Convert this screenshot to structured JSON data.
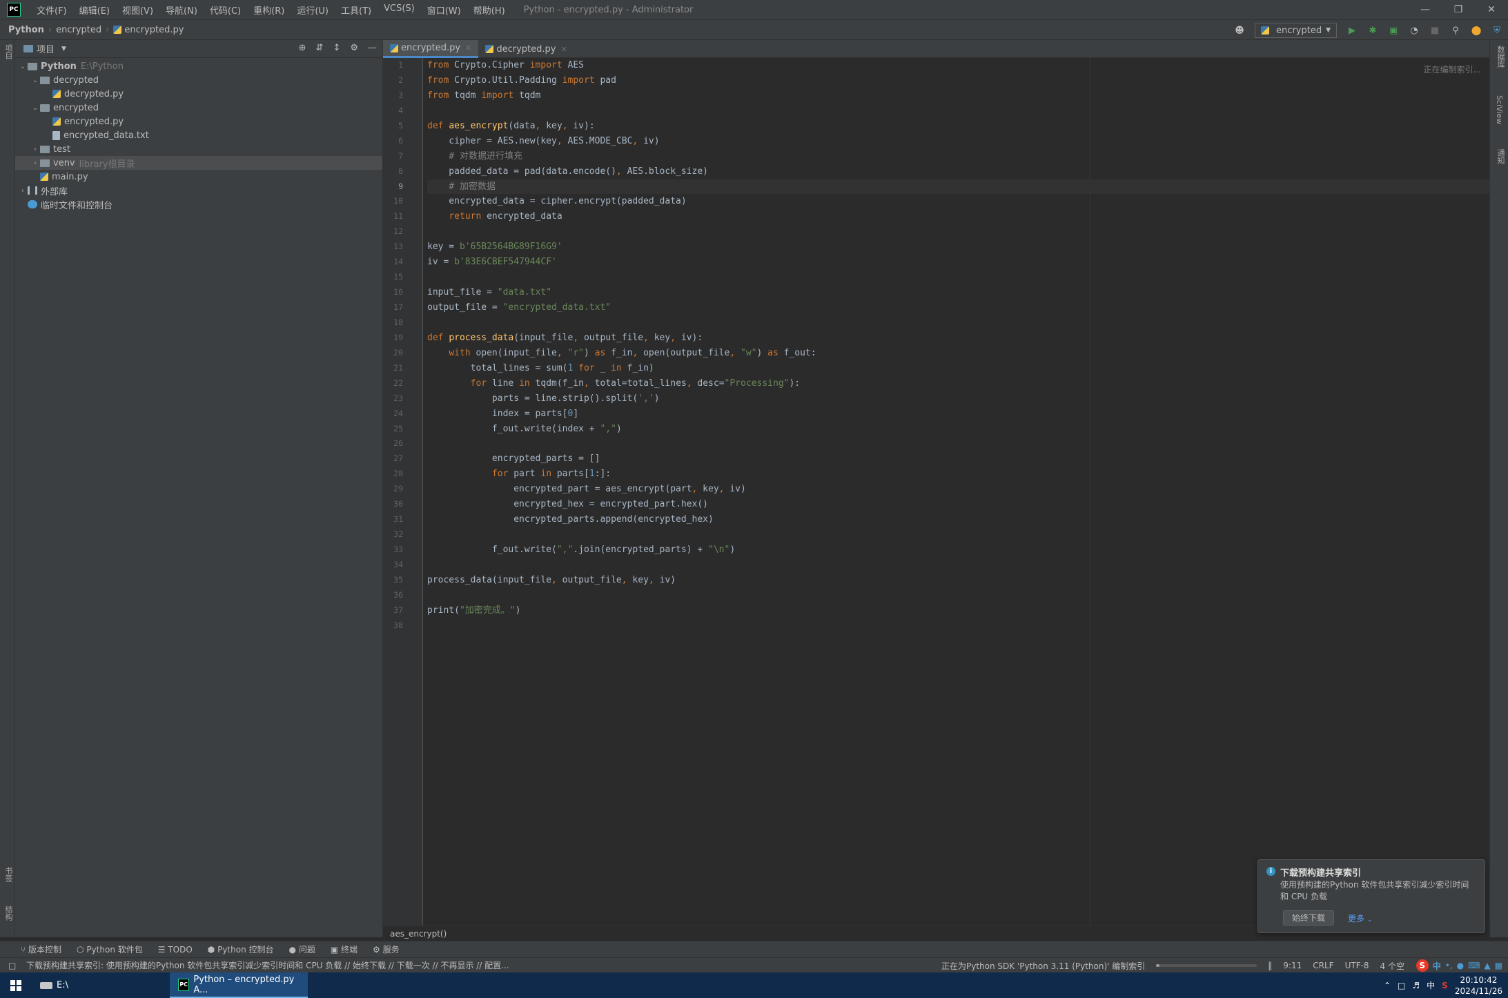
{
  "window": {
    "title": "Python - encrypted.py - Administrator",
    "menu": [
      "文件(F)",
      "编辑(E)",
      "视图(V)",
      "导航(N)",
      "代码(C)",
      "重构(R)",
      "运行(U)",
      "工具(T)",
      "VCS(S)",
      "窗口(W)",
      "帮助(H)"
    ],
    "logo": "PC"
  },
  "navbar": {
    "breadcrumb": [
      "Python",
      "encrypted",
      "encrypted.py"
    ],
    "run_config": "encrypted"
  },
  "project": {
    "header": "项目",
    "tree": [
      {
        "label": "Python",
        "hint": "E:\\Python",
        "depth": 0,
        "type": "folder",
        "expanded": true,
        "bold": true
      },
      {
        "label": "decrypted",
        "depth": 1,
        "type": "folder",
        "expanded": true
      },
      {
        "label": "decrypted.py",
        "depth": 2,
        "type": "py"
      },
      {
        "label": "encrypted",
        "depth": 1,
        "type": "folder",
        "expanded": true
      },
      {
        "label": "encrypted.py",
        "depth": 2,
        "type": "py"
      },
      {
        "label": "encrypted_data.txt",
        "depth": 2,
        "type": "txt"
      },
      {
        "label": "test",
        "depth": 1,
        "type": "folder",
        "expanded": false
      },
      {
        "label": "venv",
        "hint": "library根目录",
        "depth": 1,
        "type": "folder",
        "expanded": false,
        "selected": true
      },
      {
        "label": "main.py",
        "depth": 1,
        "type": "py"
      },
      {
        "label": "外部库",
        "depth": 0,
        "type": "lib",
        "expanded": false
      },
      {
        "label": "临时文件和控制台",
        "depth": 0,
        "type": "scratch"
      }
    ]
  },
  "left_strip": {
    "top_label": "项目",
    "bottom_labels": [
      "书签",
      "结构"
    ]
  },
  "right_strip": {
    "labels": [
      "数据库",
      "SciView",
      "通知"
    ]
  },
  "tabs": [
    {
      "label": "encrypted.py",
      "active": true
    },
    {
      "label": "decrypted.py",
      "active": false
    }
  ],
  "editor": {
    "indexing_hint": "正在编制索引...",
    "current_line": 9,
    "lines": [
      "from Crypto.Cipher import AES",
      "from Crypto.Util.Padding import pad",
      "from tqdm import tqdm",
      "",
      "def aes_encrypt(data, key, iv):",
      "    cipher = AES.new(key, AES.MODE_CBC, iv)",
      "    # 对数据进行填充",
      "    padded_data = pad(data.encode(), AES.block_size)",
      "    # 加密数据",
      "    encrypted_data = cipher.encrypt(padded_data)",
      "    return encrypted_data",
      "",
      "key = b'65B2564BG89F16G9'",
      "iv = b'83E6CBEF547944CF'",
      "",
      "input_file = \"data.txt\"",
      "output_file = \"encrypted_data.txt\"",
      "",
      "def process_data(input_file, output_file, key, iv):",
      "    with open(input_file, \"r\") as f_in, open(output_file, \"w\") as f_out:",
      "        total_lines = sum(1 for _ in f_in)",
      "        for line in tqdm(f_in, total=total_lines, desc=\"Processing\"):",
      "            parts = line.strip().split(',')",
      "            index = parts[0]",
      "            f_out.write(index + \",\")",
      "",
      "            encrypted_parts = []",
      "            for part in parts[1:]:",
      "                encrypted_part = aes_encrypt(part, key, iv)",
      "                encrypted_hex = encrypted_part.hex()",
      "                encrypted_parts.append(encrypted_hex)",
      "",
      "            f_out.write(\",\".join(encrypted_parts) + \"\\n\")",
      "",
      "process_data(input_file, output_file, key, iv)",
      "",
      "print(\"加密完成。\")",
      ""
    ]
  },
  "structure_crumb": "aes_encrypt()",
  "tool_windows": [
    "版本控制",
    "Python 软件包",
    "TODO",
    "Python 控制台",
    "问题",
    "终端",
    "服务"
  ],
  "status": {
    "message": "下载预构建共享索引: 使用预构建的Python 软件包共享索引减少索引时间和 CPU 负载 // 始终下载 // 下载一次 // 不再显示 // 配置...",
    "indexing": "正在为Python SDK 'Python 3.11 (Python)' 编制索引",
    "progress": 0.03,
    "position": "9:11",
    "line_sep": "CRLF",
    "encoding": "UTF-8",
    "indent": "4 个空"
  },
  "notification": {
    "title": "下载预构建共享索引",
    "body": "使用预构建的Python 软件包共享索引减少索引时间和 CPU 负载",
    "button": "始终下载",
    "more": "更多"
  },
  "taskbar": {
    "items": [
      {
        "label": "E:\\",
        "active": false
      },
      {
        "label": "Python – encrypted.py A...",
        "active": true
      }
    ],
    "ime": "中",
    "time": "20:10:42",
    "date": "2024/11/26"
  },
  "colors": {
    "accent": "#4a88c7",
    "keyword": "#cc7832",
    "string": "#6a8759",
    "comment": "#808080"
  }
}
